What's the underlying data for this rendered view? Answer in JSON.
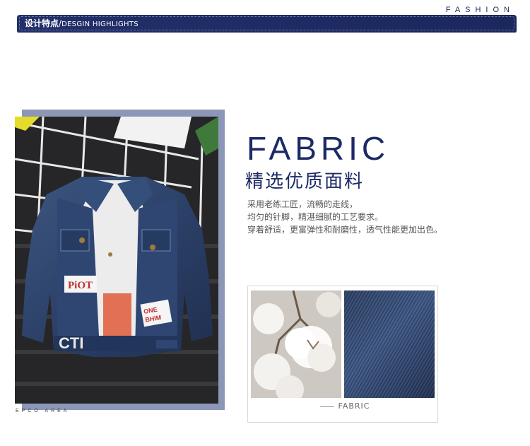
{
  "header": {
    "fashion_label": "FASHION",
    "title_cn": "设计特点",
    "title_separator": "/",
    "title_en": "DESGIN HIGHLIGHTS"
  },
  "photo": {
    "patch_left": "PiOT",
    "patch_right_line1": "ONE",
    "patch_right_line2": "BHIM",
    "shirt_text": "CTI",
    "caption": "EPCO AREA"
  },
  "fabric": {
    "title": "FABRIC",
    "subtitle": "精选优质面料",
    "description": [
      "采用老练工匠，流畅的走线，",
      "均匀的针脚，精湛细腻的工艺要求。",
      "穿着舒适，更富弹性和耐磨性，透气性能更加出色。"
    ],
    "card_label": "FABRIC"
  },
  "colors": {
    "banner": "#1e2a63",
    "title": "#1c2a66",
    "photo_frame": "#8c97b8"
  }
}
